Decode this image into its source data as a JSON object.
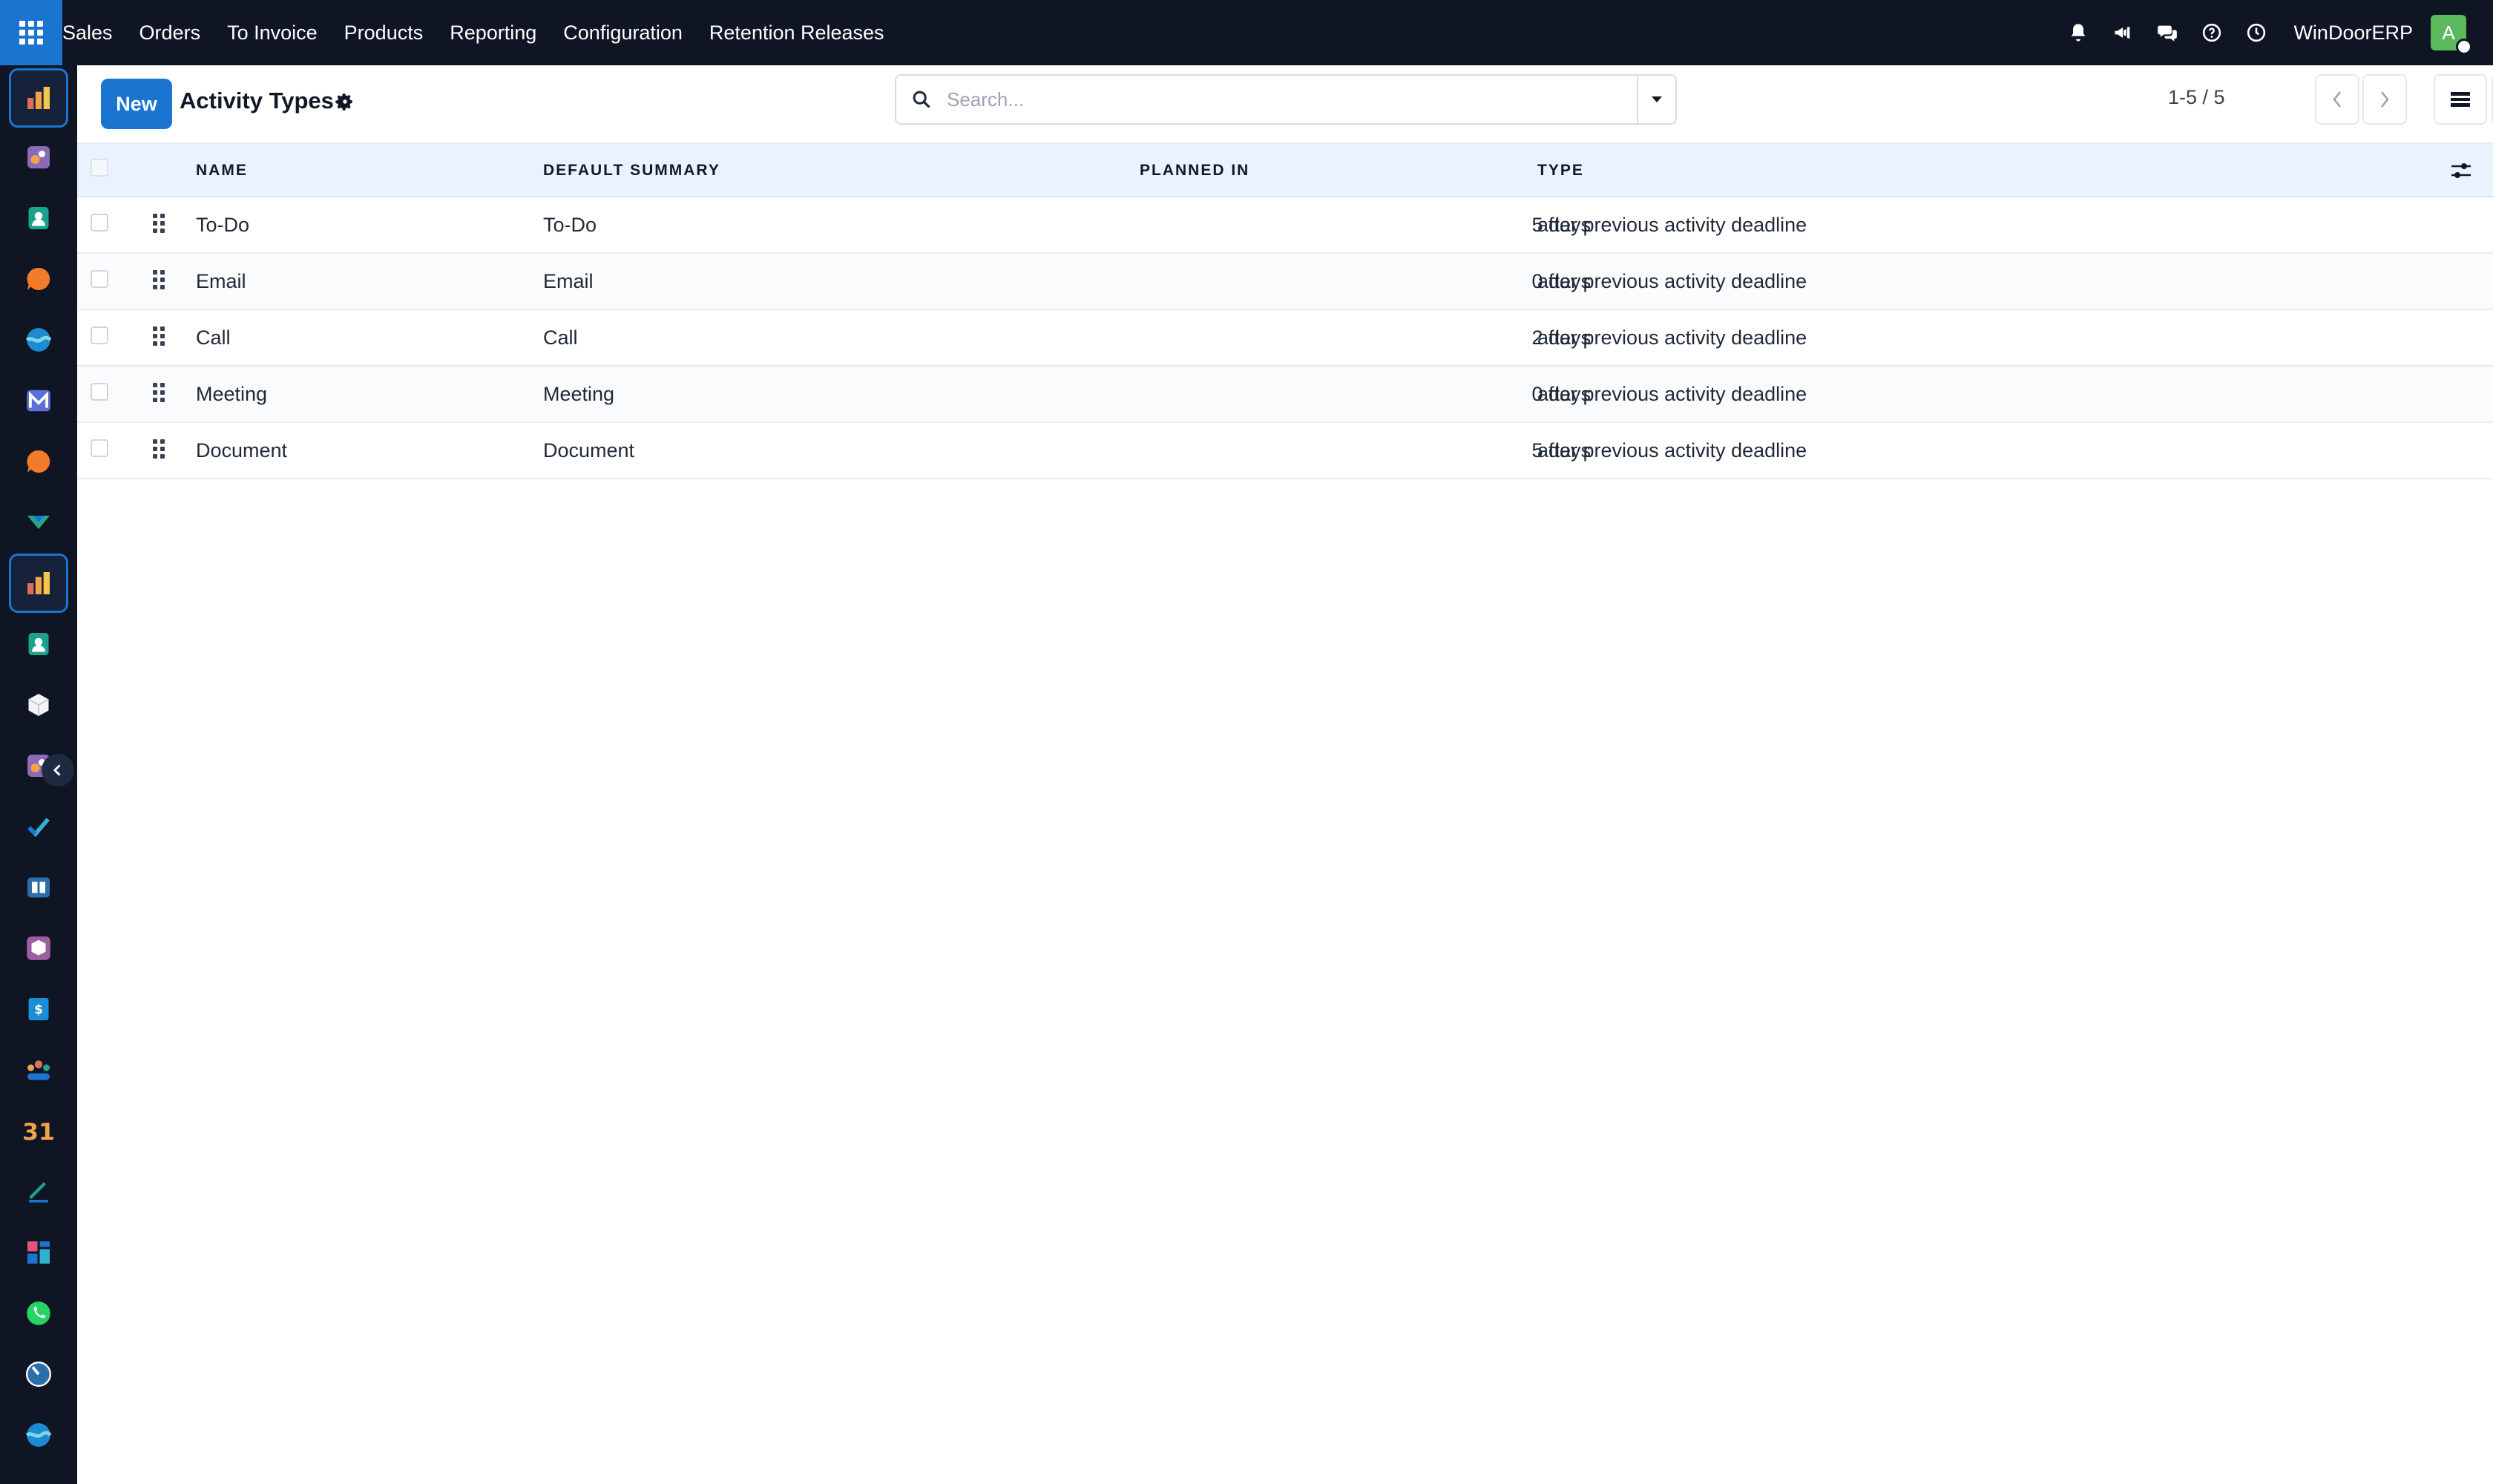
{
  "navbar": {
    "menu": [
      "Sales",
      "Orders",
      "To Invoice",
      "Products",
      "Reporting",
      "Configuration",
      "Retention Releases"
    ],
    "company": "WinDoorERP",
    "avatar_letter": "A"
  },
  "rail": {
    "apps": [
      "sales-app",
      "ai-app",
      "contacts-app",
      "discuss-app",
      "website-app",
      "email-marketing-app",
      "livechat-app",
      "fleet-app",
      "sales-app-active",
      "employees-app",
      "inventory-app",
      "rental-app",
      "project-app",
      "knowledge-app",
      "inventory-box-app",
      "invoicing-app",
      "team-app",
      "calendar-app",
      "sign-app",
      "dashboards-app",
      "whatsapp-app",
      "timesheets-app",
      "website-builder-app"
    ]
  },
  "control_panel": {
    "new_label": "New",
    "title": "Activity Types",
    "search_placeholder": "Search...",
    "pager": "1-5 / 5"
  },
  "table": {
    "columns": [
      "NAME",
      "DEFAULT SUMMARY",
      "PLANNED IN",
      "TYPE"
    ],
    "rows": [
      {
        "name": "To-Do",
        "summary": "To-Do",
        "planned": "5 days",
        "type": "after previous activity deadline"
      },
      {
        "name": "Email",
        "summary": "Email",
        "planned": "0 days",
        "type": "after previous activity deadline"
      },
      {
        "name": "Call",
        "summary": "Call",
        "planned": "2 days",
        "type": "after previous activity deadline"
      },
      {
        "name": "Meeting",
        "summary": "Meeting",
        "planned": "0 days",
        "type": "after previous activity deadline"
      },
      {
        "name": "Document",
        "summary": "Document",
        "planned": "5 days",
        "type": "after previous activity deadline"
      }
    ]
  },
  "colors": {
    "navbar": "#0f1523",
    "primary": "#1b75d0",
    "header_bg": "#eaf3fd"
  }
}
